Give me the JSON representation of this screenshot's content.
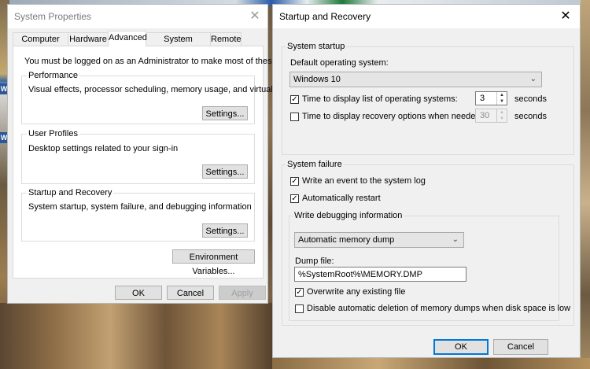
{
  "system_properties": {
    "title": "System Properties",
    "tabs": [
      "Computer Name",
      "Hardware",
      "Advanced",
      "System Protection",
      "Remote"
    ],
    "admin_note": "You must be logged on as an Administrator to make most of these changes.",
    "performance": {
      "label": "Performance",
      "desc": "Visual effects, processor scheduling, memory usage, and virtual memory",
      "button": "Settings..."
    },
    "user_profiles": {
      "label": "User Profiles",
      "desc": "Desktop settings related to your sign-in",
      "button": "Settings..."
    },
    "startup_recovery": {
      "label": "Startup and Recovery",
      "desc": "System startup, system failure, and debugging information",
      "button": "Settings..."
    },
    "env_button": "Environment Variables...",
    "ok": "OK",
    "cancel": "Cancel",
    "apply": "Apply"
  },
  "startup_dialog": {
    "title": "Startup and Recovery",
    "system_startup": {
      "label": "System startup",
      "default_os_label": "Default operating system:",
      "default_os_value": "Windows 10",
      "time_list_label": "Time to display list of operating systems:",
      "time_list_checked": true,
      "time_list_value": "3",
      "time_recovery_label": "Time to display recovery options when needed:",
      "time_recovery_checked": false,
      "time_recovery_value": "30",
      "seconds": "seconds"
    },
    "system_failure": {
      "label": "System failure",
      "write_event_label": "Write an event to the system log",
      "write_event_checked": true,
      "auto_restart_label": "Automatically restart",
      "auto_restart_checked": true,
      "debug_label": "Write debugging information",
      "debug_value": "Automatic memory dump",
      "dump_file_label": "Dump file:",
      "dump_file_value": "%SystemRoot%\\MEMORY.DMP",
      "overwrite_label": "Overwrite any existing file",
      "overwrite_checked": true,
      "disable_delete_label": "Disable automatic deletion of memory dumps when disk space is low",
      "disable_delete_checked": false
    },
    "ok": "OK",
    "cancel": "Cancel"
  },
  "desktop_icon_letter": "W",
  "colors": {
    "accent": "#0078d7",
    "word_blue": "#2b579a"
  }
}
